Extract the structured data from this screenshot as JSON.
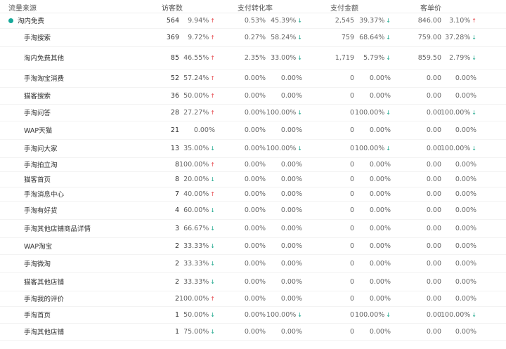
{
  "header": {
    "source": "流量来源",
    "visitors": "访客数",
    "conversion": "支付转化率",
    "amount": "支付金额",
    "unit_price": "客单价"
  },
  "colors": {
    "up": "#e5464b",
    "down": "#17a589",
    "dot": "#16a89a"
  },
  "rows": [
    {
      "name": "淘内免费",
      "parent": true,
      "visitors": "564",
      "visitors_chg": "9.94%",
      "visitors_dir": "up",
      "conv": "0.53%",
      "conv_chg": "45.39%",
      "conv_dir": "down",
      "amount": "2,545",
      "amount_chg": "39.37%",
      "amount_dir": "down",
      "price": "846.00",
      "price_chg": "3.10%",
      "price_dir": "up"
    },
    {
      "name": "手淘搜索",
      "visitors": "369",
      "visitors_chg": "9.72%",
      "visitors_dir": "up",
      "conv": "0.27%",
      "conv_chg": "58.24%",
      "conv_dir": "down",
      "amount": "759",
      "amount_chg": "68.64%",
      "amount_dir": "down",
      "price": "759.00",
      "price_chg": "37.28%",
      "price_dir": "down"
    },
    {
      "name": "淘内免费其他",
      "visitors": "85",
      "visitors_chg": "46.55%",
      "visitors_dir": "up",
      "conv": "2.35%",
      "conv_chg": "33.00%",
      "conv_dir": "down",
      "amount": "1,719",
      "amount_chg": "5.79%",
      "amount_dir": "down",
      "price": "859.50",
      "price_chg": "2.79%",
      "price_dir": "down"
    },
    {
      "name": "手淘淘宝消费",
      "visitors": "52",
      "visitors_chg": "57.24%",
      "visitors_dir": "up",
      "conv": "0.00%",
      "conv_chg": "0.00%",
      "conv_dir": "",
      "amount": "0",
      "amount_chg": "0.00%",
      "amount_dir": "",
      "price": "0.00",
      "price_chg": "0.00%",
      "price_dir": ""
    },
    {
      "name": "猫客搜索",
      "visitors": "36",
      "visitors_chg": "50.00%",
      "visitors_dir": "up",
      "conv": "0.00%",
      "conv_chg": "0.00%",
      "conv_dir": "",
      "amount": "0",
      "amount_chg": "0.00%",
      "amount_dir": "",
      "price": "0.00",
      "price_chg": "0.00%",
      "price_dir": ""
    },
    {
      "name": "手淘问答",
      "visitors": "28",
      "visitors_chg": "27.27%",
      "visitors_dir": "up",
      "conv": "0.00%",
      "conv_chg": "100.00%",
      "conv_dir": "down",
      "amount": "0",
      "amount_chg": "100.00%",
      "amount_dir": "down",
      "price": "0.00",
      "price_chg": "100.00%",
      "price_dir": "down"
    },
    {
      "name": "WAP天猫",
      "visitors": "21",
      "visitors_chg": "0.00%",
      "visitors_dir": "",
      "conv": "0.00%",
      "conv_chg": "0.00%",
      "conv_dir": "",
      "amount": "0",
      "amount_chg": "0.00%",
      "amount_dir": "",
      "price": "0.00",
      "price_chg": "0.00%",
      "price_dir": ""
    },
    {
      "name": "手淘问大家",
      "visitors": "13",
      "visitors_chg": "35.00%",
      "visitors_dir": "down",
      "conv": "0.00%",
      "conv_chg": "100.00%",
      "conv_dir": "down",
      "amount": "0",
      "amount_chg": "100.00%",
      "amount_dir": "down",
      "price": "0.00",
      "price_chg": "100.00%",
      "price_dir": "down"
    },
    {
      "name": "手淘拍立淘",
      "visitors": "8",
      "visitors_chg": "100.00%",
      "visitors_dir": "up",
      "conv": "0.00%",
      "conv_chg": "0.00%",
      "conv_dir": "",
      "amount": "0",
      "amount_chg": "0.00%",
      "amount_dir": "",
      "price": "0.00",
      "price_chg": "0.00%",
      "price_dir": ""
    },
    {
      "name": "猫客首页",
      "visitors": "8",
      "visitors_chg": "20.00%",
      "visitors_dir": "down",
      "conv": "0.00%",
      "conv_chg": "0.00%",
      "conv_dir": "",
      "amount": "0",
      "amount_chg": "0.00%",
      "amount_dir": "",
      "price": "0.00",
      "price_chg": "0.00%",
      "price_dir": ""
    },
    {
      "name": "手淘消息中心",
      "visitors": "7",
      "visitors_chg": "40.00%",
      "visitors_dir": "up",
      "conv": "0.00%",
      "conv_chg": "0.00%",
      "conv_dir": "",
      "amount": "0",
      "amount_chg": "0.00%",
      "amount_dir": "",
      "price": "0.00",
      "price_chg": "0.00%",
      "price_dir": ""
    },
    {
      "name": "手淘有好货",
      "visitors": "4",
      "visitors_chg": "60.00%",
      "visitors_dir": "down",
      "conv": "0.00%",
      "conv_chg": "0.00%",
      "conv_dir": "",
      "amount": "0",
      "amount_chg": "0.00%",
      "amount_dir": "",
      "price": "0.00",
      "price_chg": "0.00%",
      "price_dir": ""
    },
    {
      "name": "手淘其他店铺商品详情",
      "visitors": "3",
      "visitors_chg": "66.67%",
      "visitors_dir": "down",
      "conv": "0.00%",
      "conv_chg": "0.00%",
      "conv_dir": "",
      "amount": "0",
      "amount_chg": "0.00%",
      "amount_dir": "",
      "price": "0.00",
      "price_chg": "0.00%",
      "price_dir": ""
    },
    {
      "name": "WAP淘宝",
      "visitors": "2",
      "visitors_chg": "33.33%",
      "visitors_dir": "down",
      "conv": "0.00%",
      "conv_chg": "0.00%",
      "conv_dir": "",
      "amount": "0",
      "amount_chg": "0.00%",
      "amount_dir": "",
      "price": "0.00",
      "price_chg": "0.00%",
      "price_dir": ""
    },
    {
      "name": "手淘微淘",
      "visitors": "2",
      "visitors_chg": "33.33%",
      "visitors_dir": "down",
      "conv": "0.00%",
      "conv_chg": "0.00%",
      "conv_dir": "",
      "amount": "0",
      "amount_chg": "0.00%",
      "amount_dir": "",
      "price": "0.00",
      "price_chg": "0.00%",
      "price_dir": ""
    },
    {
      "name": "猫客其他店铺",
      "visitors": "2",
      "visitors_chg": "33.33%",
      "visitors_dir": "down",
      "conv": "0.00%",
      "conv_chg": "0.00%",
      "conv_dir": "",
      "amount": "0",
      "amount_chg": "0.00%",
      "amount_dir": "",
      "price": "0.00",
      "price_chg": "0.00%",
      "price_dir": ""
    },
    {
      "name": "手淘我的评价",
      "visitors": "2",
      "visitors_chg": "100.00%",
      "visitors_dir": "up",
      "conv": "0.00%",
      "conv_chg": "0.00%",
      "conv_dir": "",
      "amount": "0",
      "amount_chg": "0.00%",
      "amount_dir": "",
      "price": "0.00",
      "price_chg": "0.00%",
      "price_dir": ""
    },
    {
      "name": "手淘首页",
      "visitors": "1",
      "visitors_chg": "50.00%",
      "visitors_dir": "down",
      "conv": "0.00%",
      "conv_chg": "100.00%",
      "conv_dir": "down",
      "amount": "0",
      "amount_chg": "100.00%",
      "amount_dir": "down",
      "price": "0.00",
      "price_chg": "100.00%",
      "price_dir": "down"
    },
    {
      "name": "手淘其他店铺",
      "visitors": "1",
      "visitors_chg": "75.00%",
      "visitors_dir": "down",
      "conv": "0.00%",
      "conv_chg": "0.00%",
      "conv_dir": "",
      "amount": "0",
      "amount_chg": "0.00%",
      "amount_dir": "",
      "price": "0.00",
      "price_chg": "0.00%",
      "price_dir": ""
    }
  ]
}
